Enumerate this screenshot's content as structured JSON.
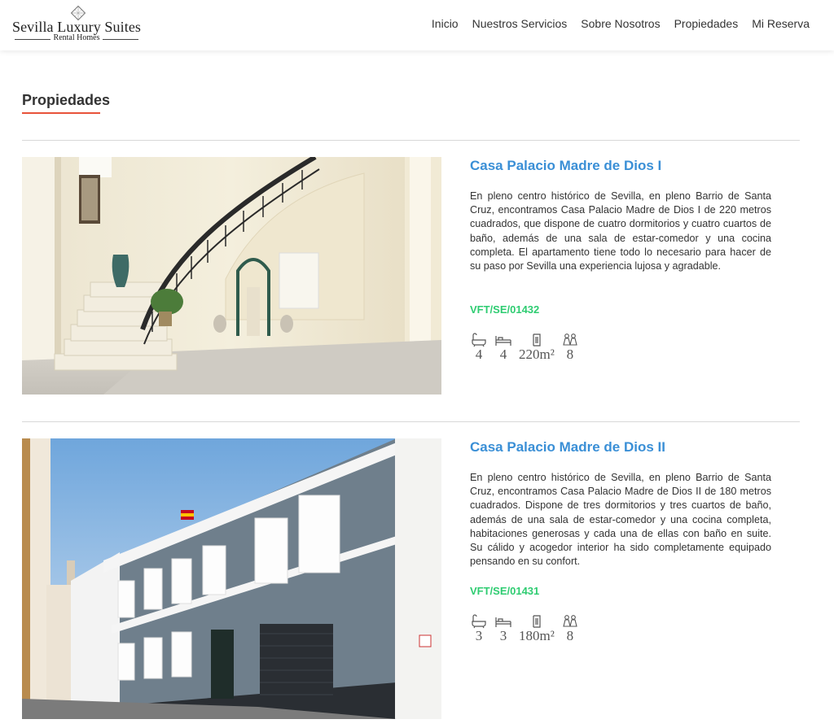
{
  "header": {
    "brand": "Sevilla Luxury Suites",
    "brand_sub": "Rental Homes",
    "nav": [
      "Inicio",
      "Nuestros Servicios",
      "Sobre Nosotros",
      "Propiedades",
      "Mi Reserva"
    ]
  },
  "section": {
    "title": "Propiedades"
  },
  "properties": [
    {
      "title": "Casa Palacio Madre de Dios I",
      "description": "En pleno centro histórico de Sevilla, en pleno Barrio de Santa Cruz, encontramos Casa Palacio Madre de Dios I de 220 metros cuadrados, que dispone de cuatro dormitorios y cuatro cuartos de baño, además de una sala de estar-comedor y una cocina completa. El apartamento tiene todo lo necesario para hacer de su paso por Sevilla una experiencia lujosa y agradable.",
      "code": "VFT/SE/01432",
      "bathrooms": "4",
      "bedrooms": "4",
      "area": "220m²",
      "guests": "8",
      "image": "interior-staircase-photo"
    },
    {
      "title": "Casa Palacio Madre de Dios II",
      "description": "En pleno centro histórico de Sevilla, en pleno Barrio de Santa Cruz, encontramos Casa Palacio Madre de Dios II de 180 metros cuadrados. Dispone de tres dormitorios y tres cuartos de baño, además de una sala de estar-comedor y una cocina completa, habitaciones generosas y cada una de ellas con baño en suite. Su cálido y acogedor interior ha sido completamente equipado pensando en su confort.",
      "code": "VFT/SE/01431",
      "bathrooms": "3",
      "bedrooms": "3",
      "area": "180m²",
      "guests": "8",
      "image": "building-facade-photo"
    }
  ],
  "colors": {
    "accent": "#e8533a",
    "link": "#3a8fd6",
    "code": "#2ecc71"
  }
}
